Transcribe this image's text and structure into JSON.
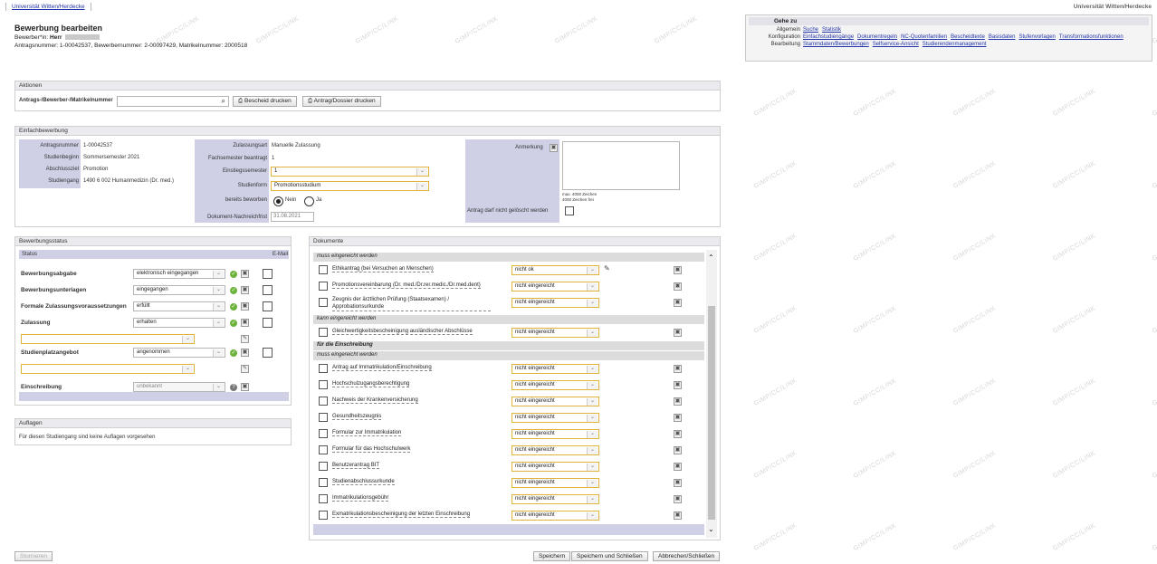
{
  "topbar": {
    "tab": "Universität Witten/Herdecke",
    "brand": "Universität Witten/Herdecke"
  },
  "header": {
    "title": "Bewerbung bearbeiten",
    "applicant_prefix": "Bewerber*in",
    "applicant_salutation": "Herr",
    "numbers": "Antragsnummer: 1-00042537, Bewerbernummer: 2-00097429, Matrikelnummer: 2000518"
  },
  "goto": {
    "title": "Gehe zu",
    "rows": [
      {
        "label": "Allgemein",
        "links": [
          "Suche",
          "Statistik"
        ]
      },
      {
        "label": "Konfiguration",
        "links": [
          "Einfachstudiengänge",
          "Dokumentregeln",
          "NC-Quotenfamilien",
          "Bescheidtexte",
          "Basisdaten",
          "Stufenvorlagen",
          "Transformationsfunktionen"
        ]
      },
      {
        "label": "Bearbeitung",
        "links": [
          "Stammdaten/Bewerbungen",
          "Selfservice-Ansicht",
          "Studierendenmanagement"
        ]
      }
    ]
  },
  "aktionen": {
    "title": "Aktionen",
    "search_label": "Antrags-/Bewerber-/Matrikelnummer",
    "btn_bescheid": "Bescheid drucken",
    "btn_dossier": "Antrag/Dossier drucken"
  },
  "einfach": {
    "title": "Einfachbewerbung",
    "antragsnummer_label": "Antragsnummer",
    "antragsnummer": "1-00042537",
    "studienbeginn_label": "Studienbeginn",
    "studienbeginn": "Sommersemester 2021",
    "abschluss_label": "Abschlussziel",
    "abschluss": "Promotion",
    "studiengang_label": "Studiengang",
    "studiengang": "1490 6 002 Humanmedizin (Dr. med.)",
    "zulassungsart_label": "Zulassungsart",
    "zulassungsart": "Manuelle Zulassung",
    "fachsem_label": "Fachsemester beantragt",
    "fachsem": "1",
    "einstieg_label": "Einstiegssemester",
    "einstieg": "1",
    "studienform_label": "Studienform",
    "studienform": "Promotionsstudium",
    "beworben_label": "bereits beworben",
    "nein": "Nein",
    "ja": "Ja",
    "frist_label": "Dokument-Nachreichfrist",
    "frist": "31.08.2021",
    "anmerkung_label": "Anmerkung",
    "max_chars": "max. 4000 Zeichen",
    "chars_free": "4000 Zeichen frei",
    "nicht_loeschen": "Antrag darf nicht gelöscht werden"
  },
  "status": {
    "title": "Bewerbungsstatus",
    "col_status": "Status",
    "col_email": "E-Mail",
    "rows": [
      {
        "label": "Bewerbungsabgabe",
        "value": "elektronisch eingegangen"
      },
      {
        "label": "Bewerbungsunterlagen",
        "value": "eingegangen"
      },
      {
        "label": "Formale Zulassungsvoraussetzungen",
        "value": "erfüllt"
      },
      {
        "label": "Zulassung",
        "value": "erhalten"
      },
      {
        "label": "Studienplatzangebot",
        "value": "angenommen"
      },
      {
        "label": "Einschreibung",
        "value": "unbekannt"
      }
    ]
  },
  "auflagen": {
    "title": "Auflagen",
    "text": "Für diesen Studiengang sind keine Auflagen vorgesehen"
  },
  "dokumente": {
    "title": "Dokumente",
    "grp_muss": "muss eingereicht werden",
    "grp_kann": "kann eingereicht werden",
    "grp_einschreibung": "für die Einschreibung",
    "docs_a": [
      {
        "name": "Ethikantrag (bei Versuchen an Menschen)",
        "status": "nicht ok"
      },
      {
        "name": "Promotionsvereinbarung (Dr. med./Dr.rer.medic./Dr.med.dent)",
        "status": "nicht eingereicht"
      },
      {
        "name": "Zeugnis der ärztlichen Prüfung (Staatsexamen) / Approbationsurkunde",
        "status": "nicht eingereicht"
      }
    ],
    "docs_b": [
      {
        "name": "Gleichwertigkeitsbescheinigung ausländischer Abschlüsse",
        "status": "nicht eingereicht"
      }
    ],
    "docs_c": [
      {
        "name": "Antrag auf Immatrikulation/Einschreibung",
        "status": "nicht eingereicht"
      },
      {
        "name": "Hochschulzugangsberechtigung",
        "status": "nicht eingereicht"
      },
      {
        "name": "Nachweis der Krankenversicherung",
        "status": "nicht eingereicht"
      },
      {
        "name": "Gesundheitszeugnis",
        "status": "nicht eingereicht"
      },
      {
        "name": "Formular zur Immatrikulation",
        "status": "nicht eingereicht"
      },
      {
        "name": "Formular für das Hochschulwerk",
        "status": "nicht eingereicht"
      },
      {
        "name": "Benutzerantrag BIT",
        "status": "nicht eingereicht"
      },
      {
        "name": "Studienabschlussurkunde",
        "status": "nicht eingereicht"
      },
      {
        "name": "Immatrikulationsgebühr",
        "status": "nicht eingereicht"
      },
      {
        "name": "Exmatrikulationsbescheinigung der letzten Einschreibung",
        "status": "nicht eingereicht"
      }
    ]
  },
  "footer": {
    "stornieren": "Stornieren",
    "speichern": "Speichern",
    "speichern_schliessen": "Speichern und Schließen",
    "abbrechen": "Abbrechen/Schließen"
  },
  "watermark": "GIMP/CC/LINK",
  "colors": {
    "label_bg": "#cfd0e6",
    "accent_border": "#e0b43a",
    "link": "#2233aa",
    "check": "#6bb33a"
  }
}
